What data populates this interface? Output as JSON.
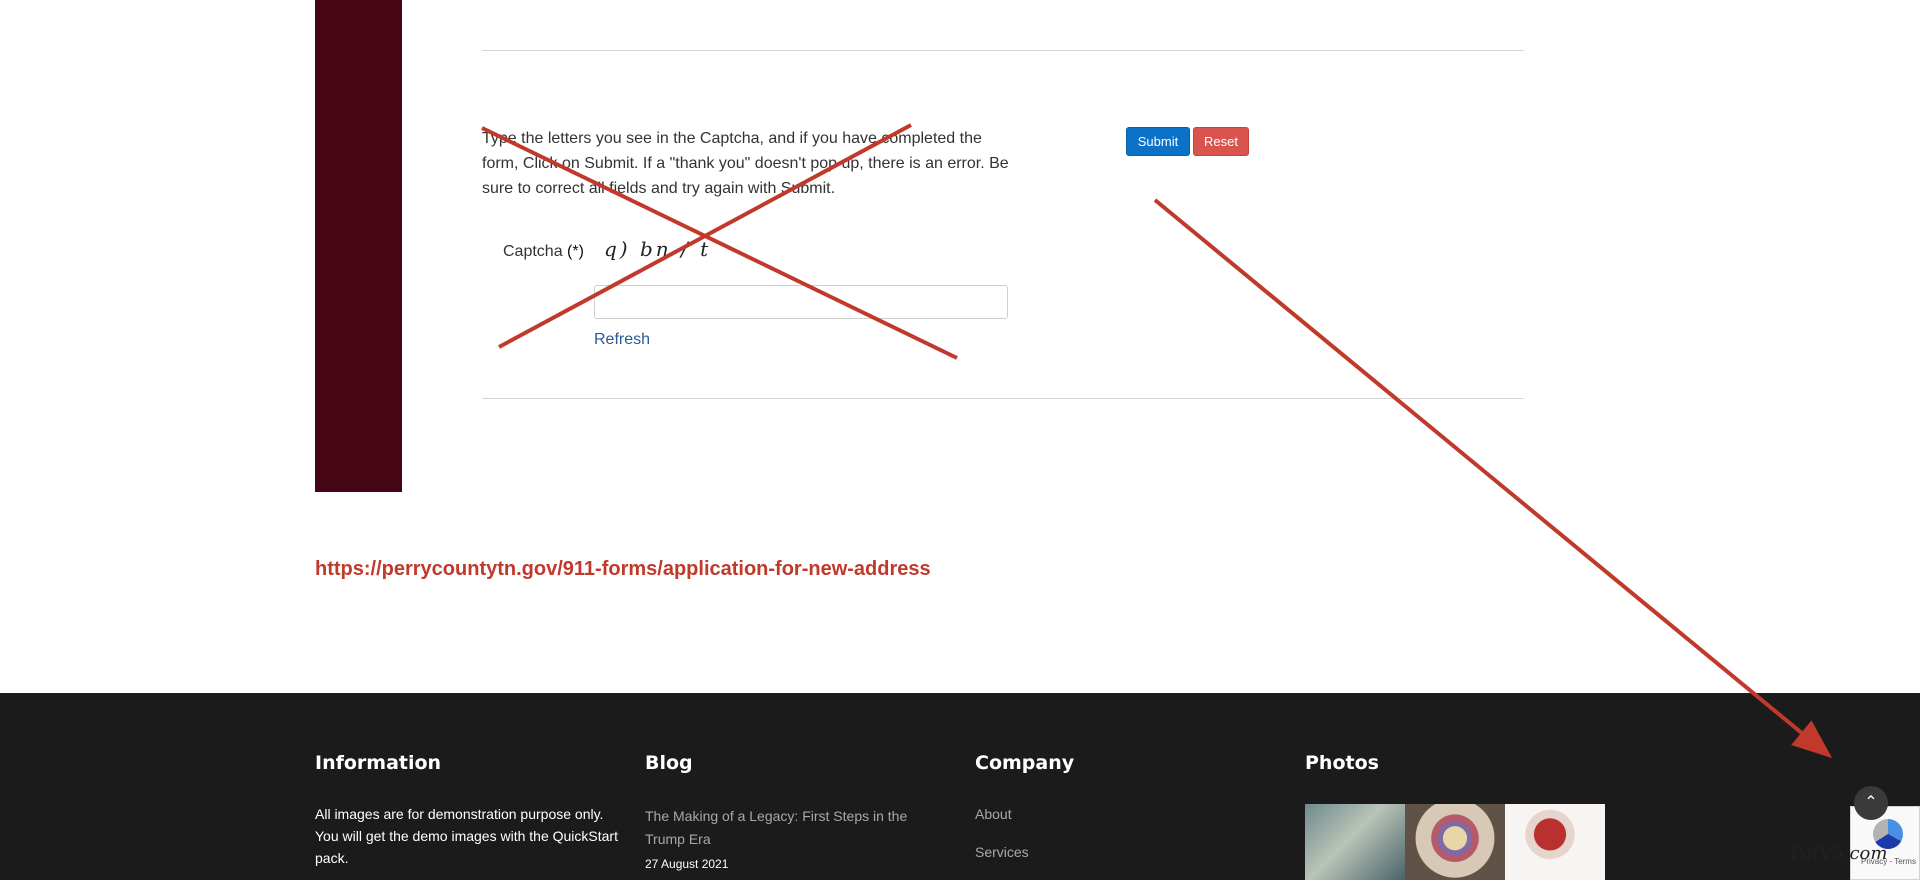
{
  "form": {
    "instructions": "Type the letters you see in the Captcha, and if you have completed the form, Click on Submit.  If a \"thank you\" doesn't pop up, there is an error.  Be sure to correct all fields and try again with Submit.",
    "submit_label": "Submit",
    "reset_label": "Reset",
    "captcha_label": "Captcha",
    "captcha_required": "(*)",
    "captcha_image_text": "q) bn / t",
    "captcha_input_value": "",
    "refresh_label": "Refresh"
  },
  "url": "https://perrycountytn.gov/911-forms/application-for-new-address",
  "footer": {
    "information": {
      "heading": "Information",
      "text": "All images are for demonstration purpose only. You will get the demo images with the QuickStart pack."
    },
    "blog": {
      "heading": "Blog",
      "post_title": "The Making of a Legacy: First Steps in the Trump Era",
      "post_date": "27 August 2021"
    },
    "company": {
      "heading": "Company",
      "links": [
        "About",
        "Services"
      ]
    },
    "photos": {
      "heading": "Photos"
    }
  },
  "scroll_top_icon": "chevron-up-icon",
  "recaptcha_terms": "Privacy - Terms",
  "watermark": "PatV5.com",
  "colors": {
    "sidebar": "#460514",
    "submit": "#0b72c8",
    "reset": "#d9534f",
    "url": "#c0392b",
    "footer": "#1b1b1b",
    "annotation": "#c0392b"
  }
}
